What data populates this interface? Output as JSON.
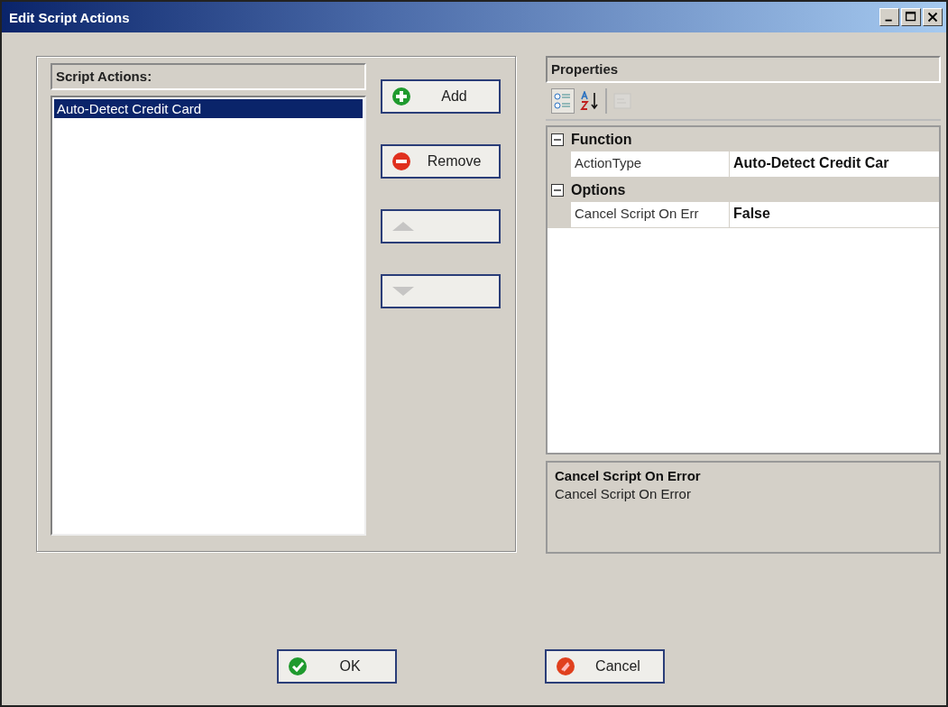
{
  "window": {
    "title": "Edit Script Actions"
  },
  "script_actions": {
    "header": "Script Actions:",
    "items": [
      {
        "label": "Auto-Detect Credit Card",
        "selected": true
      }
    ]
  },
  "action_buttons": [
    {
      "kind": "add",
      "label": "Add",
      "disabled": false
    },
    {
      "kind": "remove",
      "label": "Remove",
      "disabled": false
    },
    {
      "kind": "move_up",
      "disabled": true
    },
    {
      "kind": "move_down",
      "disabled": true
    }
  ],
  "properties": {
    "header": "Properties",
    "toolbar": [
      {
        "kind": "categorized",
        "selected": true,
        "disabled": false
      },
      {
        "kind": "alphabetical",
        "selected": false,
        "disabled": false
      },
      {
        "kind": "property_pages",
        "selected": false,
        "disabled": true
      }
    ],
    "categories": [
      {
        "name": "Function",
        "expanded": true,
        "rows": [
          {
            "name": "ActionType",
            "value": "Auto-Detect Credit Car"
          }
        ]
      },
      {
        "name": "Options",
        "expanded": true,
        "rows": [
          {
            "name": "Cancel Script On Err",
            "value": "False"
          }
        ]
      }
    ],
    "description": {
      "title": "Cancel Script On Error",
      "text": "Cancel Script On Error"
    }
  },
  "dialog_buttons": [
    {
      "kind": "ok",
      "label": "OK"
    },
    {
      "kind": "cancel",
      "label": "Cancel"
    }
  ]
}
